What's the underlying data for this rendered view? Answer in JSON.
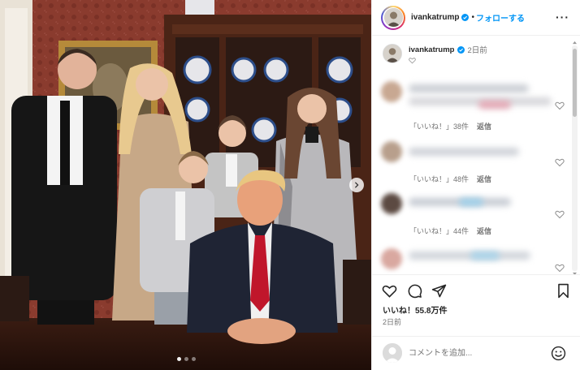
{
  "colors": {
    "accent": "#0095f6",
    "text": "#262626",
    "muted": "#737373",
    "border": "#efefef",
    "wallpaper": "#8a3b2e"
  },
  "post": {
    "username": "ivankatrump",
    "follow_separator": "•",
    "follow_label": "フォローする",
    "more_icon": "more-horizontal-icon"
  },
  "caption": {
    "username": "ivankatrump",
    "time": "2日前"
  },
  "comments": [
    {
      "likes_label": "「いいね！」38件",
      "reply_label": "返信"
    },
    {
      "likes_label": "「いいね！」48件",
      "reply_label": "返信"
    },
    {
      "likes_label": "「いいね！」44件",
      "reply_label": "返信"
    },
    {
      "likes_label": "",
      "reply_label": ""
    }
  ],
  "actions": {
    "icons": [
      "heart-icon",
      "comment-icon",
      "share-icon",
      "bookmark-icon"
    ],
    "likes": "いいね！55.8万件",
    "time": "2日前"
  },
  "add_comment": {
    "placeholder": "コメントを追加...",
    "emoji_icon": "emoji-icon"
  },
  "carousel": {
    "total": 3,
    "active": 1
  }
}
